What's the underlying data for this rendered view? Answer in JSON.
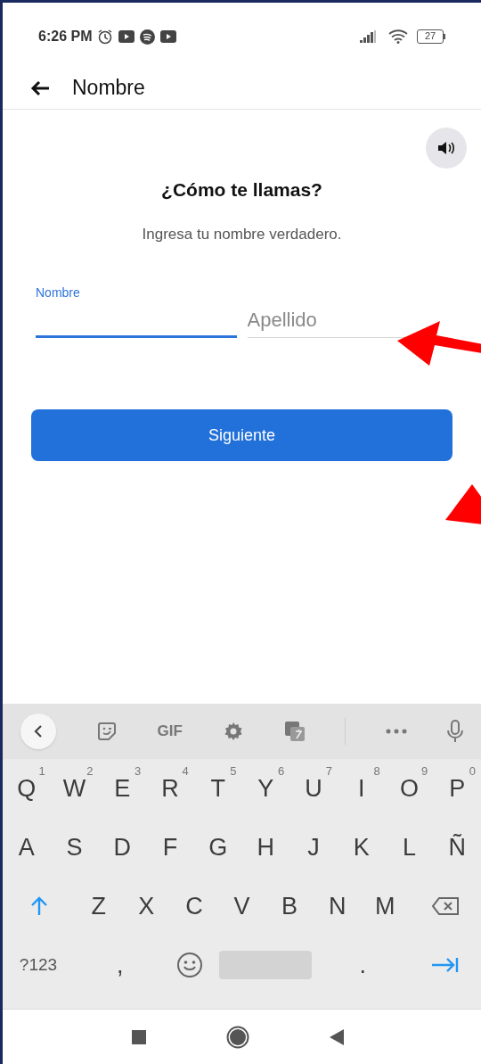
{
  "status_bar": {
    "time": "6:26 PM",
    "battery": "27"
  },
  "header": {
    "title": "Nombre"
  },
  "heading": "¿Cómo te llamas?",
  "subtitle": "Ingresa tu nombre verdadero.",
  "fields": [
    {
      "label": "Nombre",
      "focused": true
    },
    {
      "placeholder": "Apellido",
      "focused": false
    }
  ],
  "next_button": "Siguiente",
  "keyboard": {
    "toolbar": {
      "gif": "GIF"
    },
    "rows": [
      {
        "keys": [
          {
            "kind": "letter",
            "label": "Q",
            "hint": "1"
          },
          {
            "kind": "letter",
            "label": "W",
            "hint": "2"
          },
          {
            "kind": "letter",
            "label": "E",
            "hint": "3"
          },
          {
            "kind": "letter",
            "label": "R",
            "hint": "4"
          },
          {
            "kind": "letter",
            "label": "T",
            "hint": "5"
          },
          {
            "kind": "letter",
            "label": "Y",
            "hint": "6"
          },
          {
            "kind": "letter",
            "label": "U",
            "hint": "7"
          },
          {
            "kind": "letter",
            "label": "I",
            "hint": "8"
          },
          {
            "kind": "letter",
            "label": "O",
            "hint": "9"
          },
          {
            "kind": "letter",
            "label": "P",
            "hint": "0"
          }
        ]
      },
      {
        "keys": [
          {
            "kind": "letter",
            "label": "A"
          },
          {
            "kind": "letter",
            "label": "S"
          },
          {
            "kind": "letter",
            "label": "D"
          },
          {
            "kind": "letter",
            "label": "F"
          },
          {
            "kind": "letter",
            "label": "G"
          },
          {
            "kind": "letter",
            "label": "H"
          },
          {
            "kind": "letter",
            "label": "J"
          },
          {
            "kind": "letter",
            "label": "K"
          },
          {
            "kind": "letter",
            "label": "L"
          },
          {
            "kind": "letter",
            "label": "Ñ"
          }
        ]
      },
      {
        "keys": [
          {
            "kind": "shift"
          },
          {
            "kind": "letter",
            "label": "Z"
          },
          {
            "kind": "letter",
            "label": "X"
          },
          {
            "kind": "letter",
            "label": "C"
          },
          {
            "kind": "letter",
            "label": "V"
          },
          {
            "kind": "letter",
            "label": "B"
          },
          {
            "kind": "letter",
            "label": "N"
          },
          {
            "kind": "letter",
            "label": "M"
          },
          {
            "kind": "backspace"
          }
        ]
      },
      {
        "keys": [
          {
            "kind": "symbols",
            "label": "?123"
          },
          {
            "kind": "letter",
            "label": ","
          },
          {
            "kind": "emoji"
          },
          {
            "kind": "space"
          },
          {
            "kind": "letter",
            "label": "."
          },
          {
            "kind": "next"
          }
        ]
      }
    ]
  }
}
